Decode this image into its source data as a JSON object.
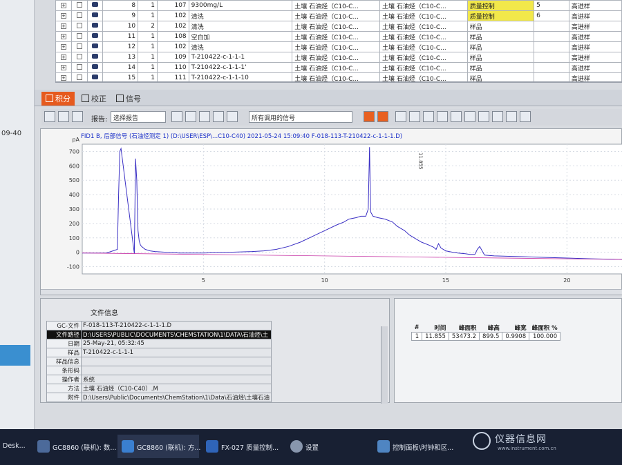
{
  "left_window": {
    "time_text": "09-40"
  },
  "sample_table": {
    "rows": [
      {
        "no": "8",
        "c2": "1",
        "c3": "107",
        "name": "9300mg/L",
        "method1": "土壤 石油烃（C10-C...",
        "method2": "土壤 石油烃（C10-C...",
        "type": "质量控制",
        "c9": "5",
        "status": "高进样"
      },
      {
        "no": "9",
        "c2": "1",
        "c3": "102",
        "name": "清洗",
        "method1": "土壤 石油烃（C10-C...",
        "method2": "土壤 石油烃（C10-C...",
        "type": "质量控制",
        "c9": "6",
        "status": "高进样"
      },
      {
        "no": "10",
        "c2": "2",
        "c3": "102",
        "name": "清洗",
        "method1": "土壤 石油烃（C10-C...",
        "method2": "土壤 石油烃（C10-C...",
        "type": "样品",
        "c9": "",
        "status": "高进样"
      },
      {
        "no": "11",
        "c2": "1",
        "c3": "108",
        "name": "空白加",
        "method1": "土壤 石油烃（C10-C...",
        "method2": "土壤 石油烃（C10-C...",
        "type": "样品",
        "c9": "",
        "status": "高进样"
      },
      {
        "no": "12",
        "c2": "1",
        "c3": "102",
        "name": "清洗",
        "method1": "土壤 石油烃（C10-C...",
        "method2": "土壤 石油烃（C10-C...",
        "type": "样品",
        "c9": "",
        "status": "高进样"
      },
      {
        "no": "13",
        "c2": "1",
        "c3": "109",
        "name": "T-210422-c-1-1-1",
        "method1": "土壤 石油烃（C10-C...",
        "method2": "土壤 石油烃（C10-C...",
        "type": "样品",
        "c9": "",
        "status": "高进样"
      },
      {
        "no": "14",
        "c2": "1",
        "c3": "110",
        "name": "T-210422-c-1-1-1'",
        "method1": "土壤 石油烃（C10-C...",
        "method2": "土壤 石油烃（C10-C...",
        "type": "样品",
        "c9": "",
        "status": "高进样"
      },
      {
        "no": "15",
        "c2": "1",
        "c3": "111",
        "name": "T-210422-c-1-1-10",
        "method1": "土壤 石油烃（C10-C...",
        "method2": "土壤 石油烃（C10-C...",
        "type": "样品",
        "c9": "",
        "status": "高进样"
      }
    ]
  },
  "tabs": [
    {
      "label": "积分"
    },
    {
      "label": "校正"
    },
    {
      "label": "信号"
    }
  ],
  "toolbar": {
    "report_label": "报告:",
    "report_value": "选择报告",
    "signal_select": "所有调用的信号"
  },
  "chart_title": "FID1 B, 后部信号 (石油烃测定 1) (D:\\USER\\ESP\\...C10-C40)   2021-05-24 15:09:40 F-018-113-T-210422-c-1-1-1.D)",
  "chart_data": {
    "type": "line",
    "y_unit": "pA",
    "yticks": [
      "700",
      "600",
      "500",
      "400",
      "300",
      "200",
      "100",
      "0",
      "-100"
    ],
    "xticks": [
      "5",
      "10",
      "15",
      "20"
    ],
    "ylim": [
      -150,
      750
    ],
    "xlim": [
      0,
      22.3
    ],
    "peak_label": "11.855",
    "series": [
      {
        "color": "#3a2fc4",
        "x": [
          0,
          1.0,
          1.45,
          1.5,
          1.55,
          1.6,
          2.15,
          2.2,
          2.25,
          2.3,
          2.35,
          2.4,
          2.45,
          2.6,
          2.8,
          3.0,
          3.5,
          4.0,
          5.0,
          6.0,
          7.0,
          7.5,
          8.0,
          8.5,
          9.0,
          9.5,
          10.0,
          10.5,
          10.8,
          11.0,
          11.3,
          11.5,
          11.7,
          11.8,
          11.855,
          11.9,
          12.0,
          12.2,
          12.5,
          12.8,
          13.0,
          13.3,
          13.5,
          13.8,
          14.0,
          14.3,
          14.5,
          14.6,
          14.7,
          14.8,
          15.0,
          15.3,
          15.5,
          15.8,
          16.0,
          16.2,
          16.3,
          16.4,
          16.6,
          17.0,
          18.0,
          19.0,
          20.0,
          21.0,
          22.3
        ],
        "y": [
          -5,
          -5,
          20,
          400,
          700,
          720,
          -10,
          650,
          500,
          150,
          80,
          50,
          40,
          20,
          10,
          5,
          0,
          -5,
          -5,
          0,
          5,
          10,
          20,
          40,
          70,
          110,
          150,
          190,
          210,
          230,
          240,
          250,
          250,
          300,
          730,
          280,
          250,
          240,
          230,
          210,
          180,
          150,
          120,
          90,
          70,
          50,
          35,
          20,
          60,
          30,
          10,
          0,
          -5,
          -10,
          -15,
          -15,
          20,
          40,
          -20,
          -25,
          -30,
          -35,
          -40,
          -45,
          -50
        ]
      },
      {
        "color": "#c83aa8",
        "x": [
          0,
          22.3
        ],
        "y": [
          -5,
          -50
        ]
      }
    ]
  },
  "file_info": {
    "heading": "文件信息",
    "rows": [
      {
        "key": "GC-文件",
        "value": "F-018-113-T-210422-c-1-1-1.D"
      },
      {
        "key": "文件路径",
        "value": "D:\\USERS\\PUBLIC\\DOCUMENTS\\CHEMSTATION\\1\\DATA\\石油烃\\土"
      },
      {
        "key": "日期",
        "value": "25-May-21, 05:32:45"
      },
      {
        "key": "样品",
        "value": "T-210422-c-1-1-1"
      },
      {
        "key": "样品信息",
        "value": ""
      },
      {
        "key": "条形码",
        "value": ""
      },
      {
        "key": "操作者",
        "value": "系统"
      },
      {
        "key": "方法",
        "value": "土壤 石油烃（C10-C40）.M"
      },
      {
        "key": "附件",
        "value": "D:\\Users\\Public\\Documents\\ChemStation\\1\\Data\\石油烃\\土壤石油"
      }
    ]
  },
  "peak_table": {
    "headers": [
      "#",
      "时间",
      "峰面积",
      "峰高",
      "峰宽",
      "峰面积 %"
    ],
    "rows": [
      [
        "1",
        "11.855",
        "53473.2",
        "899.5",
        "0.9908",
        "100.000"
      ]
    ]
  },
  "taskbar": {
    "items": [
      {
        "label": "Desk..."
      },
      {
        "label": "GC8860 (联机): 数..."
      },
      {
        "label": "GC8860 (联机): 方..."
      },
      {
        "label": "FX-027 质量控制..."
      },
      {
        "label": "设置"
      },
      {
        "label": "控制面板\\时钟和区..."
      }
    ]
  },
  "watermark": {
    "text": "仪器信息网",
    "url": "www.instrument.com.cn"
  }
}
